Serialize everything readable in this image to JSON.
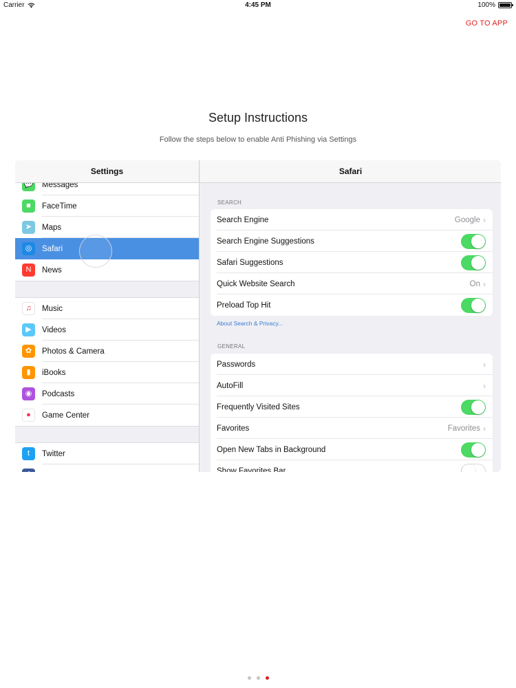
{
  "status": {
    "carrier": "Carrier",
    "time": "4:45 PM",
    "battery": "100%",
    "battery_level": 1.0
  },
  "go_to_app": "GO TO APP",
  "title": "Setup Instructions",
  "subtitle": "Follow the steps below to enable Anti Phishing via Settings",
  "settings": {
    "header": "Settings",
    "group1": [
      {
        "label": "Messages",
        "icon": "messages-icon",
        "color": "#4cd964",
        "glyph": "💬"
      },
      {
        "label": "FaceTime",
        "icon": "facetime-icon",
        "color": "#4cd964",
        "glyph": "■"
      },
      {
        "label": "Maps",
        "icon": "maps-icon",
        "color": "#7ec8e3",
        "glyph": "➤"
      },
      {
        "label": "Safari",
        "icon": "safari-icon",
        "color": "#1e88e5",
        "glyph": "◎"
      },
      {
        "label": "News",
        "icon": "news-icon",
        "color": "#ff3b30",
        "glyph": "N"
      }
    ],
    "group2": [
      {
        "label": "Music",
        "icon": "music-icon",
        "color": "#ffffff",
        "glyph": "♫"
      },
      {
        "label": "Videos",
        "icon": "videos-icon",
        "color": "#5ac8fa",
        "glyph": "▶"
      },
      {
        "label": "Photos & Camera",
        "icon": "photos-icon",
        "color": "#ff9500",
        "glyph": "✿"
      },
      {
        "label": "iBooks",
        "icon": "ibooks-icon",
        "color": "#ff9500",
        "glyph": "▮"
      },
      {
        "label": "Podcasts",
        "icon": "podcasts-icon",
        "color": "#af52de",
        "glyph": "◉"
      },
      {
        "label": "Game Center",
        "icon": "game-center-icon",
        "color": "#ffffff",
        "glyph": "●"
      }
    ],
    "group3": [
      {
        "label": "Twitter",
        "icon": "twitter-icon",
        "color": "#1da1f2",
        "glyph": "t"
      },
      {
        "label": "",
        "icon": "facebook-icon",
        "color": "#3b5998",
        "glyph": "f"
      }
    ]
  },
  "safari": {
    "header": "Safari",
    "search_label": "SEARCH",
    "search_rows": [
      {
        "label": "Search Engine",
        "value": "Google",
        "kind": "chevron"
      },
      {
        "label": "Search Engine Suggestions",
        "kind": "toggle",
        "on": true
      },
      {
        "label": "Safari Suggestions",
        "kind": "toggle",
        "on": true
      },
      {
        "label": "Quick Website Search",
        "value": "On",
        "kind": "chevron"
      },
      {
        "label": "Preload Top Hit",
        "kind": "toggle",
        "on": true
      }
    ],
    "about_link": "About Search & Privacy...",
    "general_label": "GENERAL",
    "general_rows": [
      {
        "label": "Passwords",
        "value": "",
        "kind": "chevron"
      },
      {
        "label": "AutoFill",
        "value": "",
        "kind": "chevron"
      },
      {
        "label": "Frequently Visited Sites",
        "kind": "toggle",
        "on": true
      },
      {
        "label": "Favorites",
        "value": "Favorites",
        "kind": "chevron"
      },
      {
        "label": "Open New Tabs in Background",
        "kind": "toggle",
        "on": true
      },
      {
        "label": "Show Favorites Bar",
        "kind": "toggle",
        "on": false
      }
    ]
  },
  "page_dots": {
    "count": 3,
    "active_index": 2
  }
}
